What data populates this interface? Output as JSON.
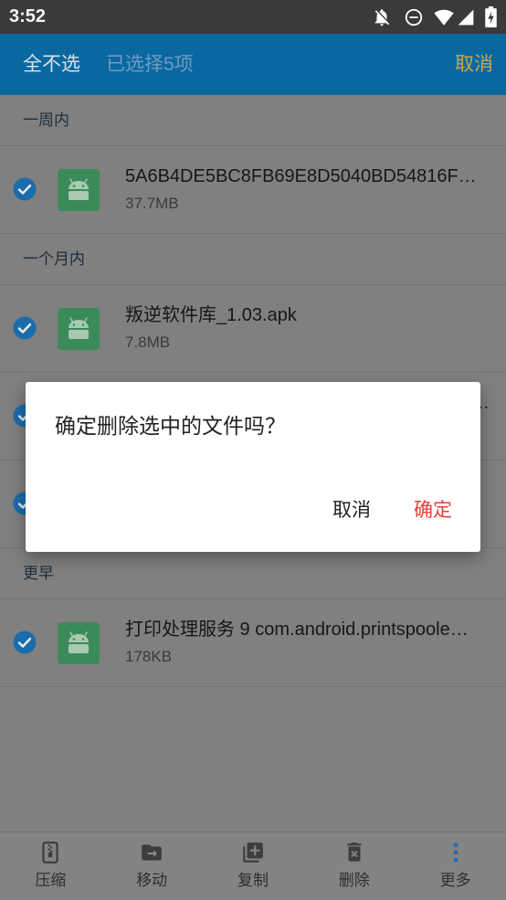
{
  "status_bar": {
    "time": "3:52",
    "icons": [
      "notifications-off-icon",
      "do-not-disturb-icon",
      "wifi-icon",
      "cellular-signal-icon",
      "battery-icon"
    ]
  },
  "app_bar": {
    "select_none": "全不选",
    "selection_count": "已选择5项",
    "cancel": "取消"
  },
  "sections": [
    {
      "header": "一周内",
      "items": [
        {
          "name": "5A6B4DE5BC8FB69E8D5040BD54816F…",
          "size": "37.7MB",
          "checked": true,
          "icon": "android-apk-icon"
        }
      ]
    },
    {
      "header": "一个月内",
      "items": [
        {
          "name": "叛逆软件库_1.03.apk",
          "size": "7.8MB",
          "checked": true,
          "icon": "android-apk-icon"
        },
        {
          "name": "…",
          "checked": true
        },
        {
          "checked": true
        }
      ]
    },
    {
      "header": "更早",
      "items": [
        {
          "name": "打印处理服务 9 com.android.printspoole…",
          "size": "178KB",
          "checked": true,
          "icon": "android-apk-icon"
        }
      ]
    }
  ],
  "dialog": {
    "message": "确定删除选中的文件吗？",
    "cancel": "取消",
    "confirm": "确定"
  },
  "bottom_bar": {
    "items": [
      {
        "label": "压缩",
        "icon": "compress-icon"
      },
      {
        "label": "移动",
        "icon": "move-folder-icon"
      },
      {
        "label": "复制",
        "icon": "copy-add-icon"
      },
      {
        "label": "删除",
        "icon": "delete-icon"
      },
      {
        "label": "更多",
        "icon": "more-vertical-icon"
      }
    ]
  },
  "colors": {
    "app_bar": "#0a68a1",
    "top_cancel": "#cea545",
    "checkbox": "#1b6cab",
    "apk_icon": "#3b8a5a",
    "confirm_button": "#e5403a",
    "more_icon": "#1d6db0"
  }
}
